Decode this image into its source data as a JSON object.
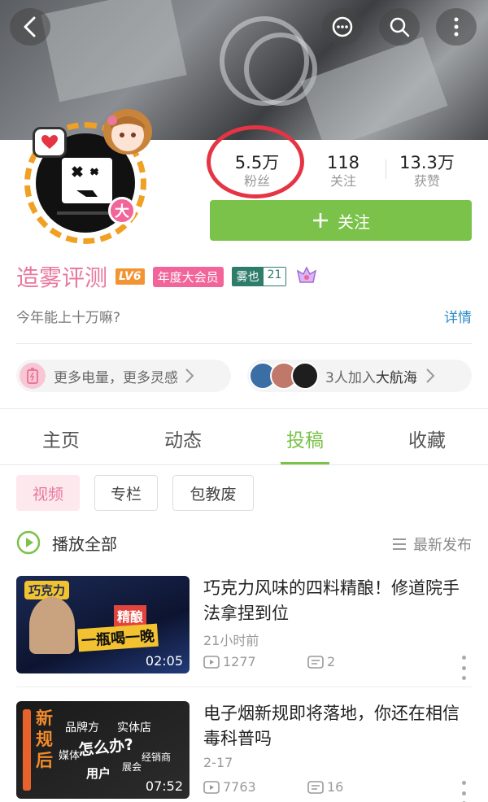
{
  "header": {
    "back_icon": "back-arrow-icon",
    "actions": [
      "message-icon",
      "search-icon",
      "more-vertical-icon"
    ]
  },
  "profile": {
    "badge_big": "大",
    "stats": [
      {
        "num": "5.5万",
        "label": "粉丝"
      },
      {
        "num": "118",
        "label": "关注"
      },
      {
        "num": "13.3万",
        "label": "获赞"
      }
    ],
    "follow_label": "关注",
    "username": "造雾评测",
    "level": "LV6",
    "vip": "年度大会员",
    "medal_name": "雾也",
    "medal_level": "21",
    "signature": "今年能上十万嘛?",
    "detail_link": "详情",
    "charge_text": "更多电量，更多灵感",
    "fleet_prefix": "3人加入",
    "fleet_strong": "大航海"
  },
  "tabs": [
    {
      "label": "主页",
      "active": false
    },
    {
      "label": "动态",
      "active": false
    },
    {
      "label": "投稿",
      "active": true
    },
    {
      "label": "收藏",
      "active": false
    }
  ],
  "filters": [
    "视频",
    "专栏",
    "包教废"
  ],
  "list_header": {
    "play_all": "播放全部",
    "sort": "最新发布"
  },
  "videos": [
    {
      "title": "巧克力风味的四料精酿！修道院手法拿捏到位",
      "time": "21小时前",
      "views": "1277",
      "comments": "2",
      "duration": "02:05",
      "thumb_text": [
        "巧克力",
        "精酿",
        "一瓶喝一晚"
      ]
    },
    {
      "title": "电子烟新规即将落地，你还在相信毒科普吗",
      "time": "2-17",
      "views": "7763",
      "comments": "16",
      "duration": "07:52",
      "thumb_text": [
        "新",
        "规",
        "后",
        "品牌方",
        "实体店",
        "怎么办?",
        "媒体",
        "经销商",
        "展会",
        "用户"
      ]
    }
  ],
  "colors": {
    "accent_green": "#7bc24a",
    "accent_pink": "#e8789e",
    "link_blue": "#2d8bc9",
    "annotation_red": "#e53545"
  }
}
